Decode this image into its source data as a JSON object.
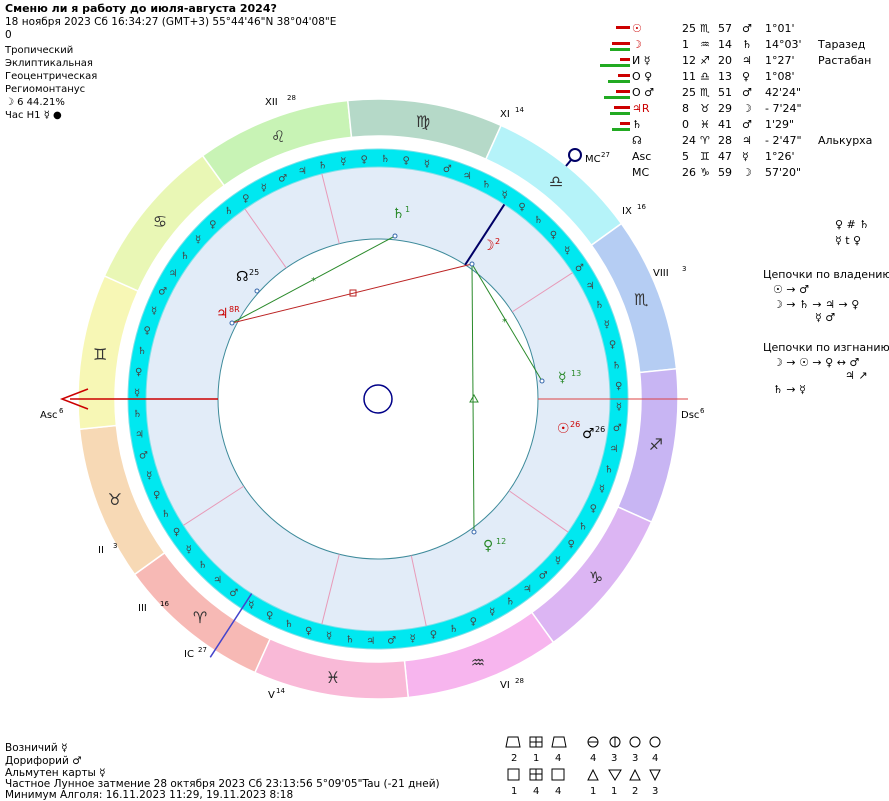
{
  "header": {
    "title": "Сменю ли я работу до июля-августа 2024?",
    "datetime": "18 ноября 2023  Сб  16:34:27 (GMT+3) 55°44'46\"N  38°04'08\"E",
    "zero": "0"
  },
  "options": {
    "zodiac": "Тропический",
    "coords": "Эклиптикальная",
    "center": "Геоцентрическая",
    "houses": "Региомонтанус",
    "moon_phase": "☽  6 44.21%",
    "hour_label": "Час H1 ☿ ●"
  },
  "planets": [
    {
      "glyph": "☉",
      "deg": "25",
      "sign": "♏",
      "min": "57",
      "dign": "♂",
      "speed": "1°01'",
      "star": "",
      "color": "#cc0000"
    },
    {
      "glyph": "☽",
      "deg": "1",
      "sign": "♒",
      "min": "14",
      "dign": "♄",
      "speed": "14°03'",
      "star": "Таразед",
      "color": "#cc0000"
    },
    {
      "glyph": "И ☿",
      "deg": "12",
      "sign": "♐",
      "min": "20",
      "dign": "♃",
      "speed": "1°27'",
      "star": "Растабан",
      "color": "#000000"
    },
    {
      "glyph": "О ♀",
      "deg": "11",
      "sign": "♎",
      "min": "13",
      "dign": "♀",
      "speed": "1°08'",
      "star": "",
      "color": "#000000"
    },
    {
      "glyph": "О ♂",
      "deg": "25",
      "sign": "♏",
      "min": "51",
      "dign": "♂",
      "speed": "42'24\"",
      "star": "",
      "color": "#000000"
    },
    {
      "glyph": "♃R",
      "deg": "8",
      "sign": "♉",
      "min": "29",
      "dign": "☽",
      "speed": "- 7'24\"",
      "star": "",
      "color": "#cc0000"
    },
    {
      "glyph": "♄",
      "deg": "0",
      "sign": "♓",
      "min": "41",
      "dign": "♂",
      "speed": "1'29\"",
      "star": "",
      "color": "#000000"
    },
    {
      "glyph": "☊",
      "deg": "24",
      "sign": "♈",
      "min": "28",
      "dign": "♃",
      "speed": "- 2'47\"",
      "star": "Алькурха",
      "color": "#000000"
    },
    {
      "glyph": "Asc",
      "deg": "5",
      "sign": "♊",
      "min": "47",
      "dign": "☿",
      "speed": "1°26'",
      "star": "",
      "color": "#000000"
    },
    {
      "glyph": "MC",
      "deg": "26",
      "sign": "♑",
      "min": "59",
      "dign": "☽",
      "speed": "57'20\"",
      "star": "",
      "color": "#000000"
    }
  ],
  "reception": {
    "line1": "♀ # ♄",
    "line2": "☿ t ♀"
  },
  "chains_rulership": {
    "title": "Цепочки по владению",
    "line1": "☉ → ♂",
    "line2": "☽ → ♄ → ♃ → ♀",
    "line3": "☿ ♂"
  },
  "chains_exile": {
    "title": "Цепочки по изгнанию",
    "line1": "☽ → ☉ → ♀ ↔ ♂",
    "line2": "♃ ↗",
    "line3": "♄ → ☿"
  },
  "chart_labels": {
    "asc": "Asc",
    "asc_sup": "6",
    "dsc": "Dsc",
    "dsc_sup": "6",
    "mc": "MC",
    "mc_sup": "27",
    "ic": "IC",
    "ic_sup": "27",
    "cusps": [
      {
        "label": "XII",
        "sup": "28"
      },
      {
        "label": "XI",
        "sup": "14"
      },
      {
        "label": "IX",
        "sup": "16"
      },
      {
        "label": "VIII",
        "sup": "3"
      },
      {
        "label": "VI",
        "sup": "28"
      },
      {
        "label": "V",
        "sup": "14"
      },
      {
        "label": "III",
        "sup": "16"
      },
      {
        "label": "II",
        "sup": "3"
      }
    ],
    "inner_planets": [
      {
        "glyph": "♄",
        "sup": "1"
      },
      {
        "glyph": "☽",
        "sup": "2"
      },
      {
        "glyph": "☊",
        "sup": "25"
      },
      {
        "glyph": "♃",
        "sup": "8R"
      },
      {
        "glyph": "☿",
        "sup": "13"
      },
      {
        "glyph": "☉",
        "sup": "26"
      },
      {
        "glyph": "♂",
        "sup": "26"
      },
      {
        "glyph": "♀",
        "sup": "12"
      }
    ],
    "signs": [
      "♓",
      "♒",
      "♑",
      "♐",
      "♏",
      "♎",
      "♍",
      "♌",
      "♋",
      "♊",
      "♉",
      "♈"
    ]
  },
  "sign_colors": [
    "#f9b9d7",
    "#f7b5ee",
    "#dcb5f3",
    "#c8b5f3",
    "#b5cdf3",
    "#b5f3f9",
    "#b5d9c8",
    "#c8f3b5",
    "#e9f7b5",
    "#f7f7b5",
    "#f7d9b5",
    "#f7b9b5"
  ],
  "bottom": {
    "ascendant_ruler": "Возничий ☿",
    "doryphory": "Дорифорий ♂",
    "almuten": "Альмутен карты ☿",
    "eclipse": "Частное Лунное затмение 28 октября 2023 Сб 23:13:56  5°09'05\"Tau (-21 дней)",
    "algol": "Минимум Алголя: 16.11.2023 11:29, 19.11.2023  8:18"
  },
  "legend": {
    "row1_nums": [
      "2",
      "1",
      "4",
      "4",
      "3",
      "3",
      "4"
    ],
    "row2_nums": [
      "1",
      "4",
      "4",
      "1",
      "1",
      "2",
      "3"
    ]
  }
}
